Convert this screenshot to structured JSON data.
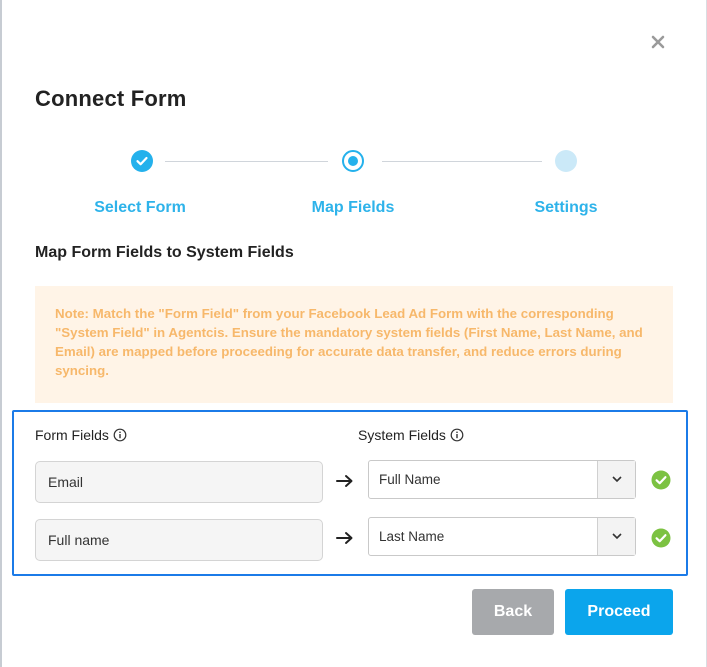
{
  "dialog": {
    "title": "Connect Form",
    "close_icon": "close-icon"
  },
  "stepper": {
    "steps": [
      {
        "label": "Select Form",
        "state": "completed"
      },
      {
        "label": "Map Fields",
        "state": "active"
      },
      {
        "label": "Settings",
        "state": "pending"
      }
    ],
    "accent": "#24b1ec"
  },
  "section": {
    "title": "Map Form Fields to System Fields"
  },
  "note": {
    "text": "Note: Match the \"Form Field\" from your Facebook Lead Ad Form with the corresponding \"System Field\" in Agentcis. Ensure the mandatory system fields (First Name, Last Name, and Email) are mapped before proceeding for accurate data transfer, and reduce errors during syncing."
  },
  "mapping": {
    "form_fields_header": "Form Fields",
    "system_fields_header": "System Fields",
    "rows": [
      {
        "form_field": "Email",
        "system_field": "Full Name",
        "status": "mapped"
      },
      {
        "form_field": "Full name",
        "system_field": "Last Name",
        "status": "mapped"
      }
    ]
  },
  "actions": {
    "back_label": "Back",
    "proceed_label": "Proceed"
  },
  "colors": {
    "primary": "#0ba5ec",
    "success": "#7cc242",
    "note_bg": "#fff4e7",
    "note_text": "#f7b86b",
    "highlight_border": "#1b7be8"
  }
}
